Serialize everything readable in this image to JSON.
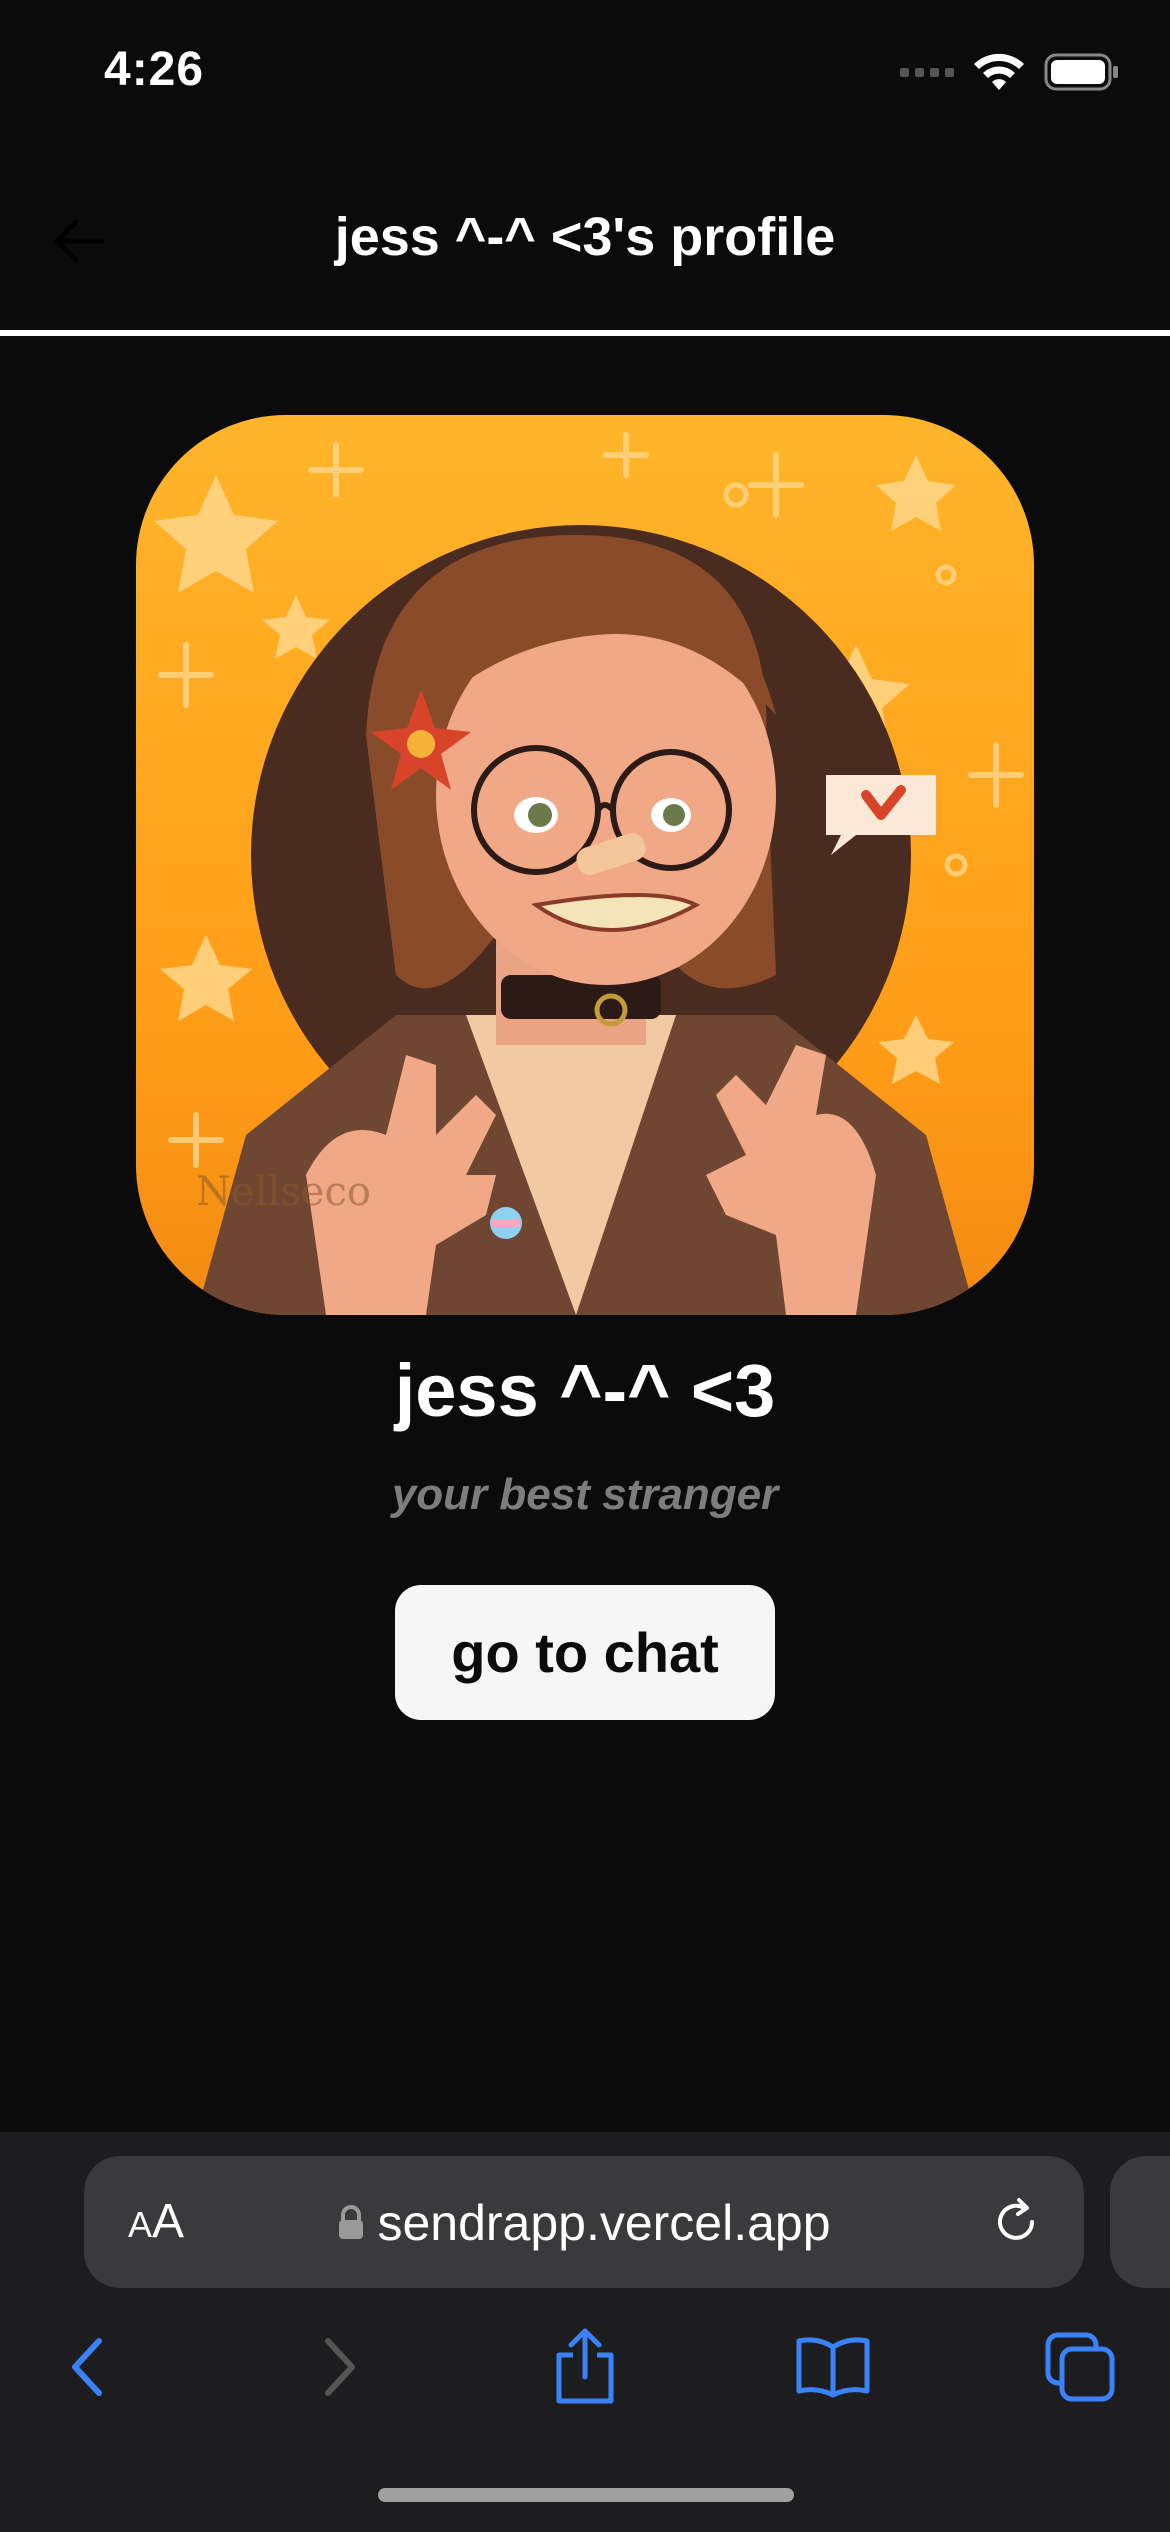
{
  "status_bar": {
    "time": "4:26"
  },
  "nav": {
    "title": "jess ^-^ <3's profile"
  },
  "profile": {
    "name": "jess ^-^ <3",
    "bio": "your best stranger",
    "avatar_signature": "Nellseco"
  },
  "actions": {
    "chat_label": "go to chat"
  },
  "browser": {
    "aa_label_small": "A",
    "aa_label_large": "A",
    "url": "sendrapp.vercel.app"
  },
  "colors": {
    "background": "#0b0b0b",
    "avatar_orange": "#ffa722",
    "button_bg": "#f5f6f5",
    "safari_blue": "#3a82f7"
  },
  "icons": {
    "back": "arrow-left-icon",
    "lock": "lock-icon",
    "reload": "reload-icon",
    "nav_back": "chevron-left-icon",
    "nav_forward": "chevron-right-icon",
    "share": "share-icon",
    "bookmarks": "book-icon",
    "tabs": "tabs-icon"
  }
}
